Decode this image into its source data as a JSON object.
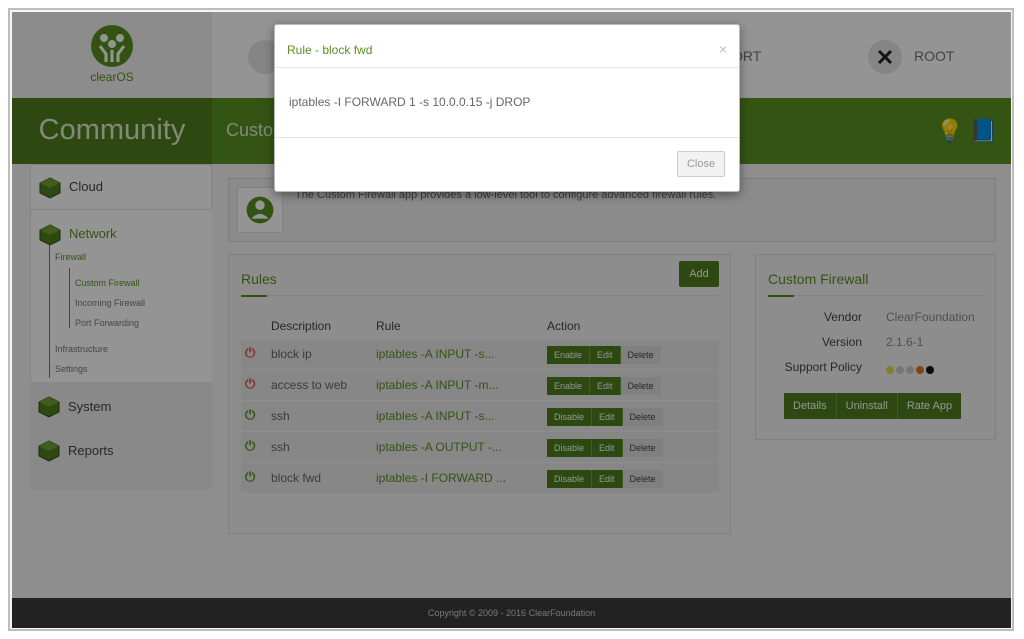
{
  "app": {
    "logo_text": "clearOS",
    "edition": "Community",
    "page_title_partial": "Custo",
    "header_items": [
      {
        "label": "ORT",
        "icon": "gauge-icon"
      },
      {
        "label": "ROOT",
        "icon": "tools-icon"
      }
    ]
  },
  "sidebar": {
    "cloud": "Cloud",
    "network": "Network",
    "network_sub": {
      "firewall": "Firewall",
      "custom_firewall": "Custom Firewall",
      "incoming_firewall": "Incoming Firewall",
      "port_forwarding": "Port Forwarding",
      "infrastructure": "Infrastructure",
      "settings": "Settings"
    },
    "system": "System",
    "reports": "Reports"
  },
  "info": {
    "description": "The Custom Firewall app provides a low-level tool to configure advanced firewall rules."
  },
  "rules": {
    "title": "Rules",
    "add_label": "Add",
    "columns": [
      "Description",
      "Rule",
      "Action"
    ],
    "rows": [
      {
        "description": "block ip",
        "rule": "iptables -A INPUT -s...",
        "enabled": false,
        "toggle_label": "Enable",
        "edit_label": "Edit",
        "delete_label": "Delete"
      },
      {
        "description": "access to web",
        "rule": "iptables -A INPUT -m...",
        "enabled": false,
        "toggle_label": "Enable",
        "edit_label": "Edit",
        "delete_label": "Delete"
      },
      {
        "description": "ssh",
        "rule": "iptables -A INPUT -s...",
        "enabled": true,
        "toggle_label": "Disable",
        "edit_label": "Edit",
        "delete_label": "Delete"
      },
      {
        "description": "ssh",
        "rule": "iptables -A OUTPUT -...",
        "enabled": true,
        "toggle_label": "Disable",
        "edit_label": "Edit",
        "delete_label": "Delete"
      },
      {
        "description": "block fwd",
        "rule": "iptables -I FORWARD ...",
        "enabled": true,
        "toggle_label": "Disable",
        "edit_label": "Edit",
        "delete_label": "Delete"
      }
    ]
  },
  "app_info": {
    "title": "Custom Firewall",
    "vendor_label": "Vendor",
    "vendor": "ClearFoundation",
    "version_label": "Version",
    "version": "2.1.6-1",
    "support_label": "Support Policy",
    "support_dots": [
      "#e8d44d",
      "#cccccc",
      "#cccccc",
      "#d9762b",
      "#111111"
    ],
    "buttons": [
      "Details",
      "Uninstall",
      "Rate App"
    ]
  },
  "footer": {
    "copyright": "Copyright © 2009 - 2016 ClearFoundation"
  },
  "modal": {
    "title": "Rule - block fwd",
    "body": "iptables -I FORWARD 1 -s 10.0.0.15 -j DROP",
    "close_symbol": "×",
    "close_button": "Close"
  },
  "colors": {
    "brand_green": "#5b9124",
    "dark_green": "#4f7f1e",
    "danger_red": "#d9534f"
  }
}
